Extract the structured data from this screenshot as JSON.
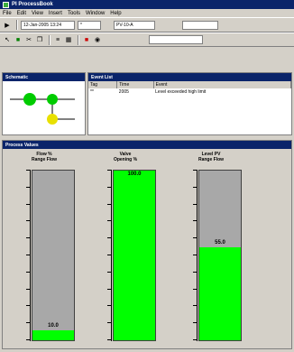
{
  "window": {
    "title": "PI ProcessBook"
  },
  "menu": [
    "File",
    "Edit",
    "View",
    "Insert",
    "Tools",
    "Window",
    "Help"
  ],
  "toolbar1": {
    "time_field": "12-Jan-2005 13:24",
    "field2": "*",
    "field3": "PV-10-A",
    "field4": ""
  },
  "schematic": {
    "title": "Schematic"
  },
  "events": {
    "title": "Event List",
    "columns": [
      "Tag",
      "Time",
      "Event"
    ],
    "rows": [
      [
        "**",
        "2005",
        "Level exceeded high limit"
      ]
    ]
  },
  "trends": {
    "title": "Process Values"
  },
  "meters": [
    {
      "label": "Flow %",
      "sublabel": "Range Flow",
      "value_text": "10.0",
      "fraction": 0.06,
      "color": "#00ff00"
    },
    {
      "label": "Valve",
      "sublabel": "Opening %",
      "value_text": "100.0",
      "fraction": 1.0,
      "color": "#00ff00"
    },
    {
      "label": "Level PV",
      "sublabel": "Range Flow",
      "value_text": "55.0",
      "fraction": 0.55,
      "color": "#00ff00"
    }
  ]
}
